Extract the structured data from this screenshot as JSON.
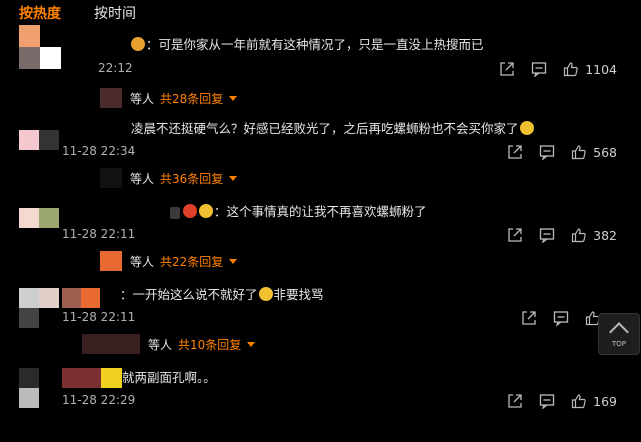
{
  "tabs": {
    "hot": "按热度",
    "time": "按时间"
  },
  "comments": [
    {
      "text": "：可是你家从一年前就有这种情况了，只是一直没上热搜而已",
      "time": "22:12",
      "likes": "1104",
      "reply_prefix": "等人",
      "reply_link": "共28条回复"
    },
    {
      "text": "凌晨不还挺硬气么？好感已经败光了，之后再吃螺蛳粉也不会买你家了",
      "time": "11-28 22:34",
      "likes": "568",
      "reply_prefix": "等人",
      "reply_link": "共36条回复"
    },
    {
      "text": "：这个事情真的让我不再喜欢螺蛳粉了",
      "time": "11-28 22:11",
      "likes": "382",
      "reply_prefix": "等人",
      "reply_link": "共22条回复"
    },
    {
      "text": "：一开始这么说不就好了",
      "text2": "非要找骂",
      "time": "11-28 22:11",
      "likes": "",
      "reply_prefix": "等人",
      "reply_link": "共10条回复"
    },
    {
      "text": "就两副面孔啊。。",
      "time": "11-28 22:29",
      "likes": "169"
    }
  ],
  "top_button": {
    "label": "TOP"
  },
  "colors": {
    "accent": "#ff8200",
    "background": "#000000"
  }
}
